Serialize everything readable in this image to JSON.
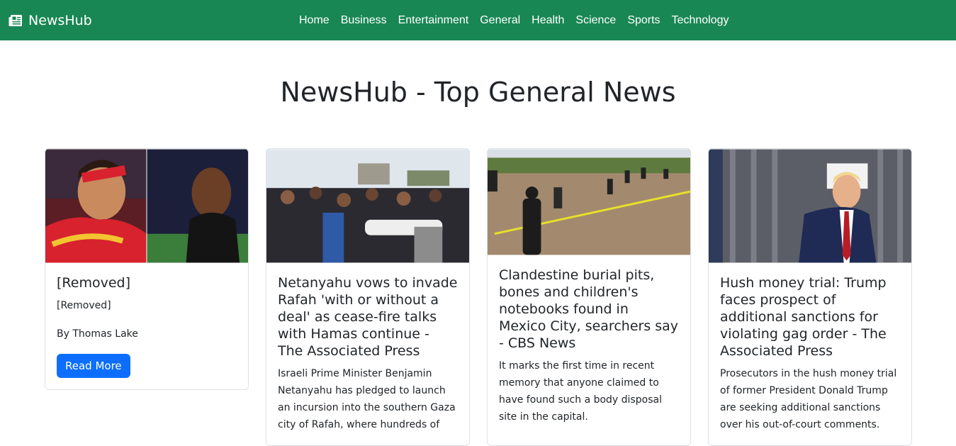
{
  "navbar": {
    "brand": "NewsHub",
    "brand_icon": "newspaper-icon",
    "bg_color": "#198754",
    "links": [
      "Home",
      "Business",
      "Entertainment",
      "General",
      "Health",
      "Science",
      "Sports",
      "Technology"
    ]
  },
  "page": {
    "title": "NewsHub - Top General News"
  },
  "cards": [
    {
      "image": "sports-players-photo",
      "title": "[Removed]",
      "description": "[Removed]",
      "author": "By Thomas Lake",
      "button": "Read More"
    },
    {
      "image": "crowd-gaza-photo",
      "title": "Netanyahu vows to invade Rafah 'with or without a deal' as cease-fire talks with Hamas continue - The Associated Press",
      "description": "Israeli Prime Minister Benjamin Netanyahu has pledged to launch an incursion into the southern Gaza city of Rafah, where hundreds of"
    },
    {
      "image": "search-field-mexico-photo",
      "title": "Clandestine burial pits, bones and children's notebooks found in Mexico City, searchers say - CBS News",
      "description": "It marks the first time in recent memory that anyone claimed to have found such a body disposal site in the capital."
    },
    {
      "image": "trump-courthouse-photo",
      "title": "Hush money trial: Trump faces prospect of additional sanctions for violating gag order - The Associated Press",
      "description": "Prosecutors in the hush money trial of former President Donald Trump are seeking additional sanctions over his out-of-court comments."
    }
  ],
  "colors": {
    "button": "#0d6efd",
    "text": "#212529"
  }
}
